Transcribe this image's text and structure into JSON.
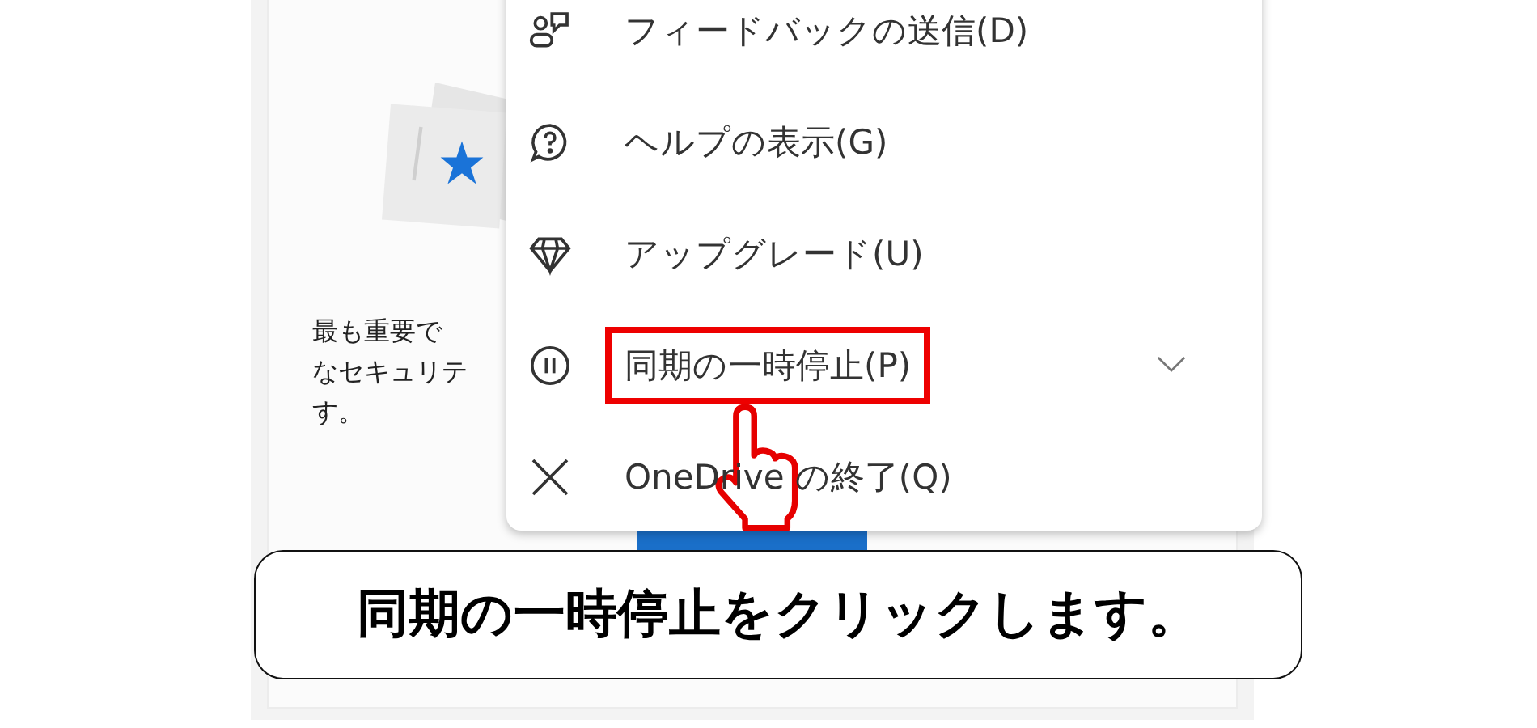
{
  "card": {
    "description_lines": [
      "最も重要で",
      "なセキュリテ",
      "す。"
    ]
  },
  "menu": {
    "items": [
      {
        "kind": "feedback",
        "label": "フィードバックの送信(D)",
        "highlighted": false,
        "has_submenu": false
      },
      {
        "kind": "help",
        "label": "ヘルプの表示(G)",
        "highlighted": false,
        "has_submenu": false
      },
      {
        "kind": "upgrade",
        "label": "アップグレード(U)",
        "highlighted": false,
        "has_submenu": false
      },
      {
        "kind": "pause",
        "label": "同期の一時停止(P)",
        "highlighted": true,
        "has_submenu": true
      },
      {
        "kind": "quit",
        "label": "OneDrive の終了(Q)",
        "highlighted": false,
        "has_submenu": false
      }
    ]
  },
  "caption": "同期の一時停止をクリックします。"
}
